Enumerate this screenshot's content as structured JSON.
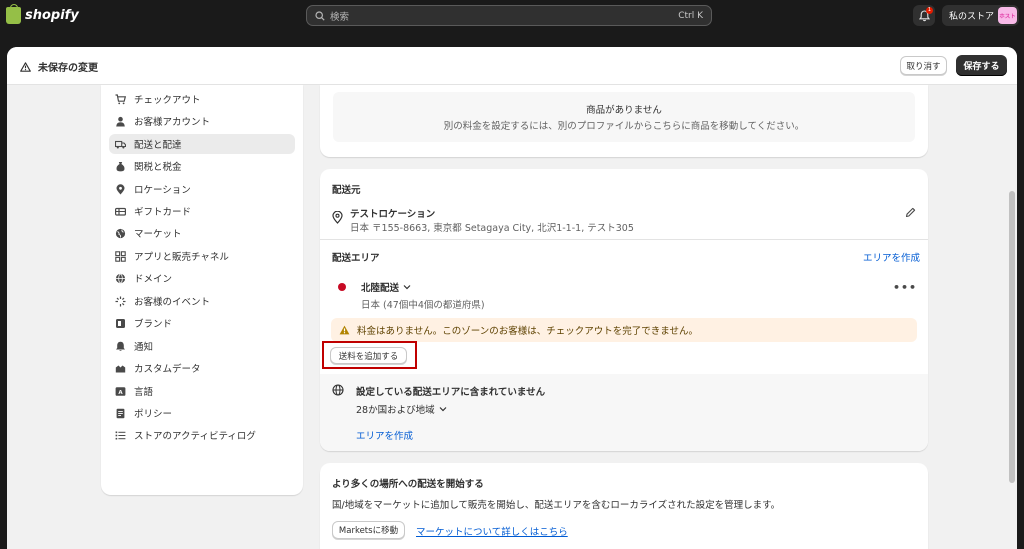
{
  "topbar": {
    "logo_text": "shopify",
    "search_placeholder": "検索",
    "search_shortcut": "Ctrl K",
    "notification_count": "1",
    "store_name": "私のストア",
    "store_avatar_text": "ホスト"
  },
  "savebar": {
    "status": "未保存の変更",
    "discard_label": "取り消す",
    "save_label": "保存する"
  },
  "sidebar": {
    "items": [
      {
        "label": "チェックアウト",
        "icon": "cart-icon"
      },
      {
        "label": "お客様アカウント",
        "icon": "person-icon"
      },
      {
        "label": "配送と配達",
        "icon": "truck-icon",
        "active": true
      },
      {
        "label": "関税と税金",
        "icon": "money-bag-icon"
      },
      {
        "label": "ロケーション",
        "icon": "location-icon"
      },
      {
        "label": "ギフトカード",
        "icon": "gift-card-icon"
      },
      {
        "label": "マーケット",
        "icon": "globe-icon"
      },
      {
        "label": "アプリと販売チャネル",
        "icon": "apps-icon"
      },
      {
        "label": "ドメイン",
        "icon": "domain-globe-icon"
      },
      {
        "label": "お客様のイベント",
        "icon": "events-icon"
      },
      {
        "label": "ブランド",
        "icon": "brand-icon"
      },
      {
        "label": "通知",
        "icon": "bell-icon"
      },
      {
        "label": "カスタムデータ",
        "icon": "custom-data-icon"
      },
      {
        "label": "言語",
        "icon": "language-icon"
      },
      {
        "label": "ポリシー",
        "icon": "policy-icon"
      },
      {
        "label": "ストアのアクティビティログ",
        "icon": "list-icon"
      }
    ]
  },
  "products_card": {
    "empty_title": "商品がありません",
    "empty_description": "別の料金を設定するには、別のプロファイルからこちらに商品を移動してください。"
  },
  "shipping_card": {
    "origin_heading": "配送元",
    "location_name": "テストロケーション",
    "location_address": "日本 〒155-8663, 東京都 Setagaya City, 北沢1-1-1, テスト305",
    "area_heading": "配送エリア",
    "create_area_link": "エリアを作成",
    "zone_name": "北陸配送",
    "zone_detail": "日本 (47個中4個の都道府県)",
    "zone_color": "#c70a24",
    "warning_text": "料金はありません。このゾーンのお客様は、チェックアウトを完了できません。",
    "add_rate_label": "送料を追加する",
    "not_included_title": "設定している配送エリアに含まれていません",
    "not_included_count": "28か国および地域",
    "not_included_link": "エリアを作成"
  },
  "markets_card": {
    "title": "より多くの場所への配送を開始する",
    "description": "国/地域をマーケットに追加して販売を開始し、配送エリアを含むローカライズされた設定を管理します。",
    "button_label": "Marketsに移動",
    "link_label": "マーケットについて詳しくはこちら"
  }
}
